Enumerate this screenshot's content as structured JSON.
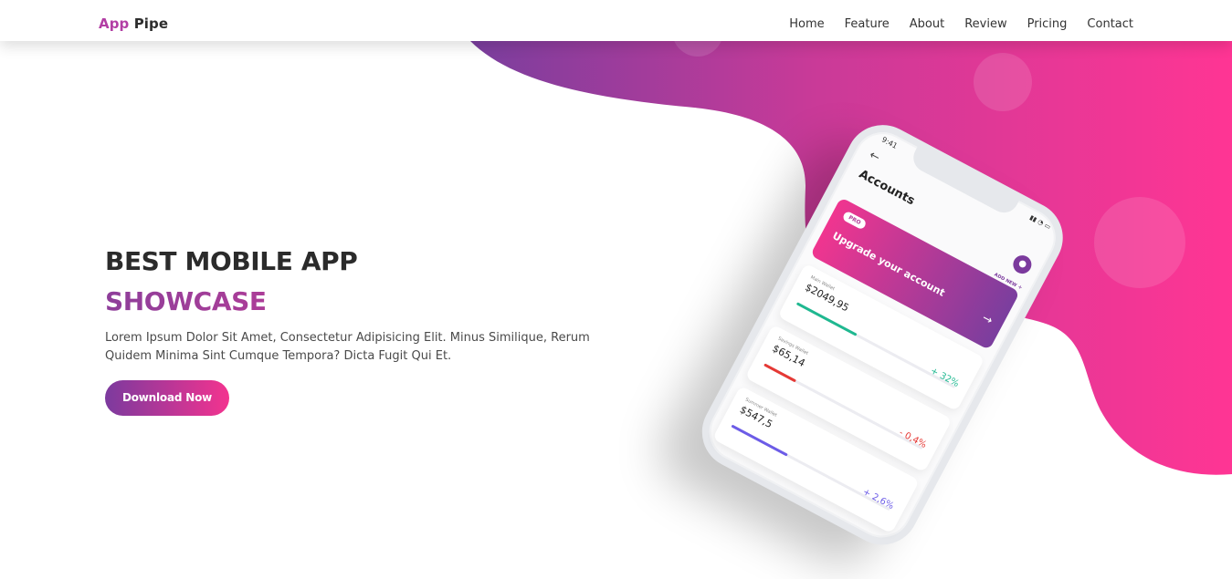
{
  "colors": {
    "brand_purple": "#7a3e9e",
    "brand_pink": "#f9358f",
    "positive": "#1fb890",
    "negative": "#e53935",
    "accent_violet": "#6c5ce7"
  },
  "header": {
    "logo_part1": "App",
    "logo_part2": "Pipe",
    "nav": [
      "Home",
      "Feature",
      "About",
      "Review",
      "Pricing",
      "Contact"
    ]
  },
  "hero": {
    "title_line1": "BEST MOBILE APP",
    "title_line2": "SHOWCASE",
    "description": "Lorem Ipsum Dolor Sit Amet, Consectetur Adipisicing Elit. Minus Similique, Rerum Quidem Minima Sint Cumque Tempora? Dicta Fugit Qui Et.",
    "button_label": "Download Now"
  },
  "phone": {
    "time": "9:41",
    "screen_title": "Accounts",
    "add_new": "ADD NEW",
    "back_icon": "arrow-left-icon",
    "avatar_icon": "user-icon",
    "upgrade": {
      "badge": "PRO",
      "text": "Upgrade your account",
      "arrow_icon": "arrow-right-icon"
    },
    "wallets": [
      {
        "name": "Main Wallet",
        "amount": "$2049,95",
        "change": "+ 32%",
        "progress": 0.38,
        "color": "#1fb890"
      },
      {
        "name": "Savings Wallet",
        "amount": "$65,14",
        "change": "- 0,4%",
        "progress": 0.2,
        "color": "#e53935"
      },
      {
        "name": "Summer Wallet",
        "amount": "$547,5",
        "change": "+ 2,6%",
        "progress": 0.35,
        "color": "#6c5ce7"
      }
    ]
  }
}
